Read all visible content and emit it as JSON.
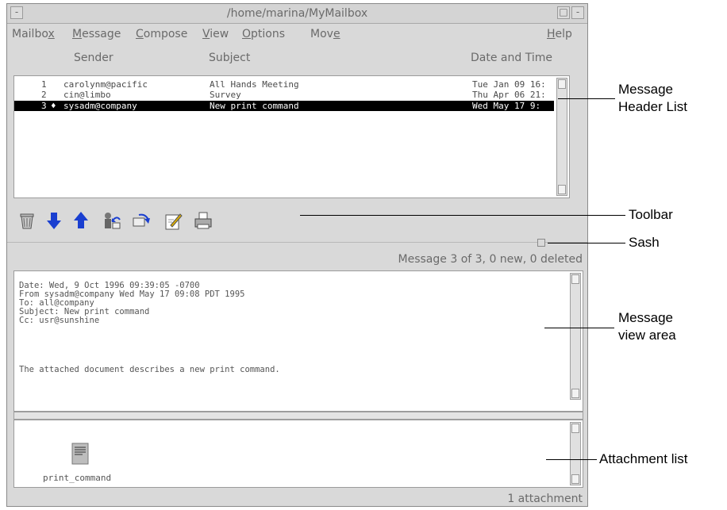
{
  "window": {
    "title": "/home/marina/MyMailbox",
    "minimize_glyph": "-",
    "maximize_glyph": "□",
    "menu_glyph": "—"
  },
  "menu": [
    {
      "pre": "Mailbo",
      "u": "x",
      "post": ""
    },
    {
      "pre": "",
      "u": "M",
      "post": "essage"
    },
    {
      "pre": "",
      "u": "C",
      "post": "ompose"
    },
    {
      "pre": "",
      "u": "V",
      "post": "iew"
    },
    {
      "pre": "",
      "u": "O",
      "post": "ptions"
    },
    {
      "pre": "Mov",
      "u": "e",
      "post": ""
    },
    {
      "pre": "",
      "u": "H",
      "post": "elp"
    }
  ],
  "list": {
    "headers": {
      "sender": "Sender",
      "subject": "Subject",
      "date": "Date and Time"
    },
    "rows": [
      {
        "num": "1",
        "flag": "",
        "sender": "carolynm@pacific",
        "subject": "All Hands Meeting",
        "date": "Tue Jan 09 16:",
        "selected": false
      },
      {
        "num": "2",
        "flag": "",
        "sender": "cin@limbo",
        "subject": "Survey",
        "date": "Thu Apr 06 21:",
        "selected": false
      },
      {
        "num": "3",
        "flag": "♦",
        "sender": "sysadm@company",
        "subject": "New print command",
        "date": "Wed May 17 9:",
        "selected": true
      }
    ]
  },
  "toolbar": {
    "icons": [
      "trash-icon",
      "next-message-icon",
      "previous-message-icon",
      "reply-icon",
      "forward-icon",
      "compose-icon",
      "print-icon"
    ]
  },
  "status": {
    "message_count": "Message 3 of 3, 0 new, 0 deleted",
    "attachments": "1 attachment"
  },
  "view": {
    "lines": [
      "Date: Wed, 9 Oct 1996 09:39:05 -0700",
      "From sysadm@company Wed May 17 09:08 PDT 1995",
      "To: all@company",
      "Subject: New print command",
      "Cc: usr@sunshine",
      "",
      "The attached document describes a new print command."
    ]
  },
  "attachment": {
    "name": "print_command",
    "icon": "document-icon"
  },
  "callouts": {
    "header_list_line1": "Message",
    "header_list_line2": "Header List",
    "toolbar": "Toolbar",
    "sash": "Sash",
    "view_line1": "Message",
    "view_line2": "view area",
    "attachment": "Attachment list"
  },
  "colors": {
    "window_bg": "#d9d9d9",
    "selected_row_bg": "#000000",
    "toolbar_arrow": "#1a3fd0"
  }
}
